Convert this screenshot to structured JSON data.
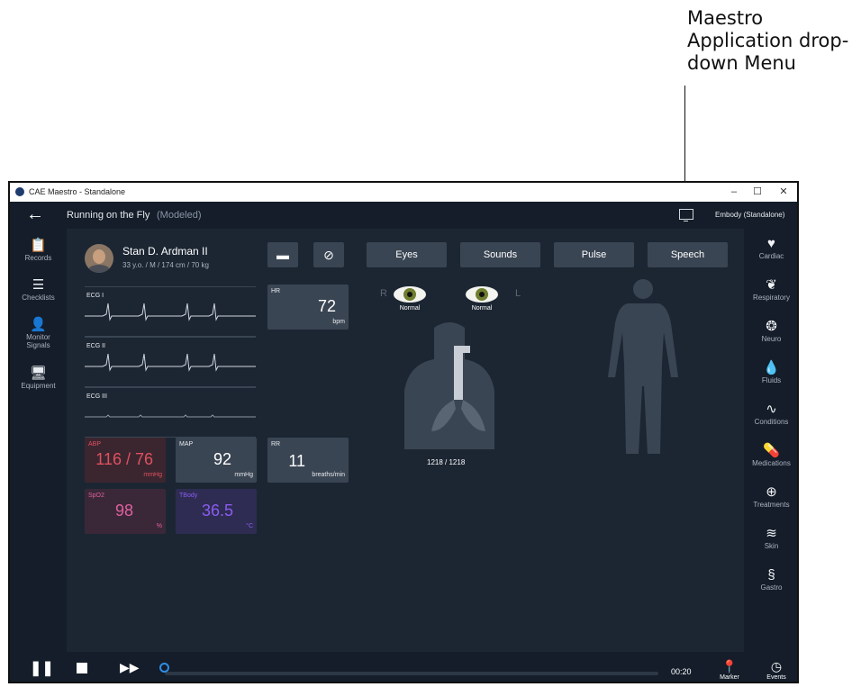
{
  "annotation": {
    "lines": [
      "Maestro",
      "Application drop-",
      "down Menu"
    ]
  },
  "window": {
    "title": "CAE Maestro - Standalone",
    "controls": [
      "–",
      "☐",
      "✕"
    ]
  },
  "header": {
    "back_icon": "back-arrow-icon",
    "scenario": "Running on the Fly",
    "mode": "(Modeled)",
    "app_menu": "Embody (Standalone)"
  },
  "left_nav": [
    {
      "icon": "clipboard-icon",
      "label": "Records"
    },
    {
      "icon": "checklist-icon",
      "label": "Checklists"
    },
    {
      "icon": "monitor-signals-icon",
      "label": "Monitor Signals"
    },
    {
      "icon": "equipment-icon",
      "label": "Equipment"
    }
  ],
  "patient": {
    "name": "Stan D. Ardman II",
    "details": "33 y.o. / M / 174 cm / 70 kg"
  },
  "tabs": [
    "Eyes",
    "Sounds",
    "Pulse",
    "Speech"
  ],
  "ecg": [
    "ECG I",
    "ECG II",
    "ECG III"
  ],
  "vitals": {
    "hr": {
      "label": "HR",
      "value": "72",
      "unit": "bpm"
    },
    "abp": {
      "label": "ABP",
      "value": "116 / 76",
      "unit": "mmHg"
    },
    "map": {
      "label": "MAP",
      "value": "92",
      "unit": "mmHg"
    },
    "rr": {
      "label": "RR",
      "value": "11",
      "unit": "breaths/min"
    },
    "spo2": {
      "label": "SpO2",
      "value": "98",
      "unit": "%"
    },
    "tbody": {
      "label": "TBody",
      "value": "36.5",
      "unit": "°C"
    }
  },
  "eyes": {
    "right_label": "R",
    "left_label": "L",
    "right_state": "Normal",
    "left_state": "Normal"
  },
  "airway": {
    "value": "1218 / 1218"
  },
  "right_nav": [
    {
      "icon": "heart-icon",
      "label": "Cardiac"
    },
    {
      "icon": "lungs-icon",
      "label": "Respiratory"
    },
    {
      "icon": "brain-icon",
      "label": "Neuro"
    },
    {
      "icon": "drop-icon",
      "label": "Fluids"
    },
    {
      "icon": "pulse-line-icon",
      "label": "Conditions"
    },
    {
      "icon": "pill-icon",
      "label": "Medications"
    },
    {
      "icon": "medkit-icon",
      "label": "Treatments"
    },
    {
      "icon": "skin-icon",
      "label": "Skin"
    },
    {
      "icon": "stomach-icon",
      "label": "Gastro"
    }
  ],
  "playback": {
    "time": "00:20",
    "marker_label": "Marker",
    "events_label": "Events"
  },
  "colors": {
    "abp": "#e0505f",
    "spo2": "#e060a0",
    "tbody": "#8a5cf0"
  }
}
